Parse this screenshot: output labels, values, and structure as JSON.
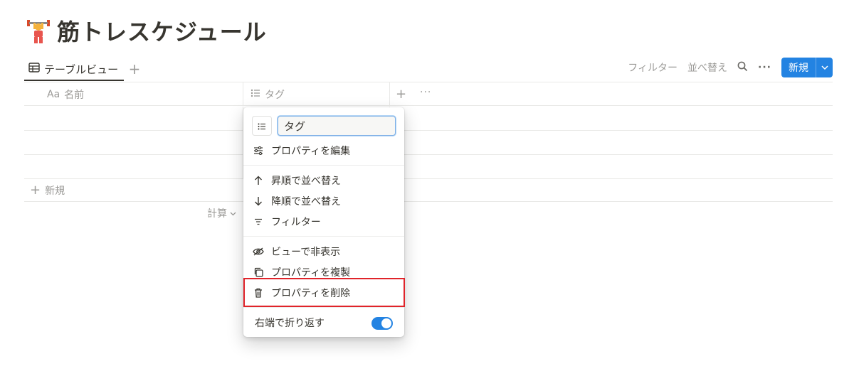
{
  "page": {
    "title": "筋トレスケジュール",
    "emoji_icon": "weight-lifter-icon"
  },
  "view_bar": {
    "tab_label": "テーブルビュー",
    "actions": {
      "filter": "フィルター",
      "sort": "並べ替え"
    },
    "new_button": "新規"
  },
  "table": {
    "columns": [
      {
        "prefix": "Aa",
        "label": "名前"
      },
      {
        "label": "タグ"
      }
    ],
    "new_row_label": "新規",
    "calc_label": "計算"
  },
  "property_menu": {
    "name_value": "タグ",
    "items": {
      "edit": "プロパティを編集",
      "sort_asc": "昇順で並べ替え",
      "sort_desc": "降順で並べ替え",
      "filter": "フィルター",
      "hide": "ビューで非表示",
      "duplicate": "プロパティを複製",
      "delete": "プロパティを削除"
    },
    "wrap_label": "右端で折り返す",
    "wrap_enabled": true
  },
  "colors": {
    "accent": "#2383e2",
    "highlight": "#e0242a",
    "text": "#37352f",
    "muted": "#9b9a97"
  }
}
